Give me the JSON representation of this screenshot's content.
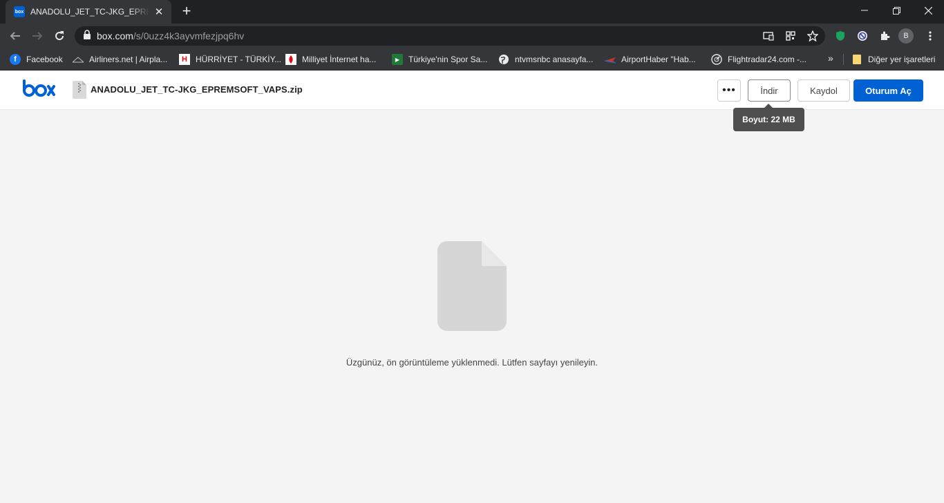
{
  "browser": {
    "tab": {
      "title": "ANADOLU_JET_TC-JKG_EPREMSOFT_VAPS.zip",
      "favicon_text": "box"
    },
    "url": {
      "host": "box.com",
      "path": "/s/0uzz4k3ayvmfezjpq6hv"
    },
    "profile_initial": "B",
    "bookmarks": [
      {
        "label": "Facebook"
      },
      {
        "label": "Airliners.net | Airpla..."
      },
      {
        "label": "HÜRRİYET - TÜRKİY..."
      },
      {
        "label": "Milliyet İnternet ha..."
      },
      {
        "label": "Türkiye'nin Spor Sa..."
      },
      {
        "label": "ntvmsnbc anasayfa..."
      },
      {
        "label": "AirportHaber \"Hab..."
      },
      {
        "label": "Flightradar24.com -..."
      }
    ],
    "bookmarks_overflow": "»",
    "other_bookmarks": "Diğer yer işaretleri"
  },
  "box": {
    "file_name": "ANADOLU_JET_TC-JKG_EPREMSOFT_VAPS.zip",
    "more_label": "•••",
    "download_label": "İndir",
    "signup_label": "Kaydol",
    "login_label": "Oturum Aç",
    "tooltip": "Boyut: 22 MB",
    "preview_error": "Üzgünüz, ön görüntüleme yüklenmedi. Lütfen sayfayı yenileyin.",
    "brand_color": "#0061d5"
  }
}
